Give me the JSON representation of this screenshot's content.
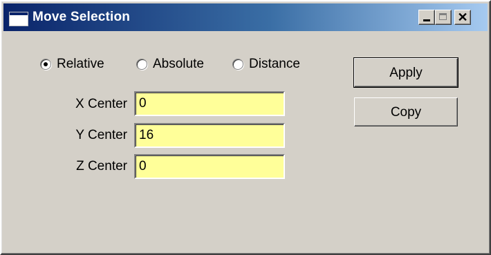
{
  "window": {
    "title": "Move Selection",
    "icon": "app-window-icon",
    "controls": {
      "minimize": "minimize-icon",
      "maximize": "maximize-icon",
      "close": "close-icon"
    },
    "close_glyph": "✕"
  },
  "mode": {
    "options": [
      {
        "label": "Relative",
        "checked": true
      },
      {
        "label": "Absolute",
        "checked": false
      },
      {
        "label": "Distance",
        "checked": false
      }
    ]
  },
  "fields": [
    {
      "label": "X Center",
      "value": "0"
    },
    {
      "label": "Y Center",
      "value": "16"
    },
    {
      "label": "Z Center",
      "value": "0"
    }
  ],
  "buttons": {
    "apply": "Apply",
    "copy": "Copy"
  },
  "colors": {
    "field_background": "#ffff99",
    "dialog_background": "#d4d0c8",
    "titlebar_start": "#0a246a",
    "titlebar_end": "#a6caf0"
  }
}
